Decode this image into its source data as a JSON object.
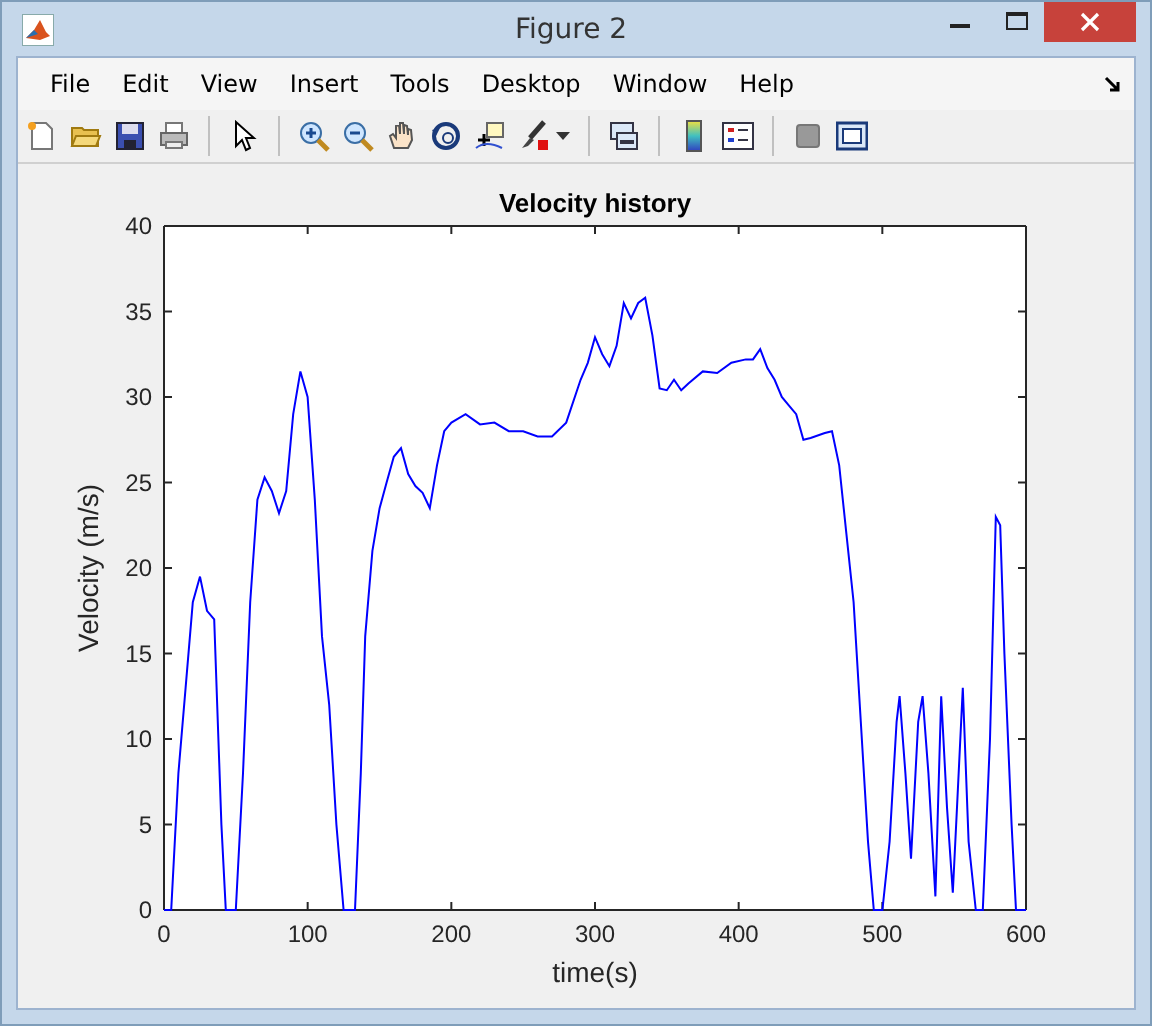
{
  "window": {
    "title": "Figure 2"
  },
  "menu": [
    "File",
    "Edit",
    "View",
    "Insert",
    "Tools",
    "Desktop",
    "Window",
    "Help"
  ],
  "figure": {
    "chart_data": {
      "type": "line",
      "title": "Velocity history",
      "xlabel": "time(s)",
      "ylabel": "Velocity (m/s)",
      "x": [
        0,
        5,
        10,
        15,
        20,
        25,
        30,
        35,
        40,
        43,
        50,
        55,
        60,
        65,
        70,
        75,
        80,
        85,
        90,
        95,
        100,
        105,
        110,
        115,
        120,
        125,
        133,
        137,
        140,
        145,
        150,
        155,
        160,
        165,
        170,
        175,
        180,
        185,
        190,
        195,
        200,
        210,
        220,
        230,
        240,
        250,
        260,
        270,
        280,
        290,
        295,
        300,
        305,
        310,
        315,
        320,
        325,
        330,
        335,
        340,
        345,
        350,
        355,
        360,
        365,
        375,
        385,
        395,
        405,
        410,
        415,
        420,
        425,
        430,
        435,
        440,
        445,
        450,
        460,
        465,
        470,
        475,
        480,
        485,
        490,
        494,
        500,
        505,
        510,
        512,
        516,
        520,
        525,
        528,
        532,
        537,
        541,
        545,
        549,
        552,
        556,
        560,
        565,
        570,
        575,
        579,
        582,
        585,
        590,
        593,
        600
      ],
      "series": [
        {
          "color": "#0000ff",
          "values": [
            0,
            0,
            8,
            13,
            18,
            19.5,
            17.5,
            17,
            5,
            0,
            0,
            8,
            18,
            24,
            25.3,
            24.5,
            23.2,
            24.5,
            29,
            31.5,
            30,
            24,
            16,
            12,
            5,
            0,
            0,
            8,
            16,
            21,
            23.5,
            25,
            26.5,
            27,
            25.5,
            24.8,
            24.4,
            23.5,
            26,
            28,
            28.5,
            29,
            28.4,
            28.5,
            28,
            28,
            27.7,
            27.7,
            28.5,
            31,
            32,
            33.5,
            32.5,
            31.8,
            33,
            35.5,
            34.6,
            35.5,
            35.8,
            33.6,
            30.5,
            30.4,
            31,
            30.4,
            30.8,
            31.5,
            31.4,
            32,
            32.2,
            32.2,
            32.8,
            31.7,
            31,
            30,
            29.5,
            29,
            27.5,
            27.6,
            27.9,
            28,
            26,
            22,
            18,
            11,
            4,
            0,
            0,
            4,
            11,
            12.5,
            8,
            3,
            11,
            12.5,
            8,
            0.8,
            12.5,
            6,
            1,
            6,
            13,
            4,
            0,
            0,
            10,
            23,
            22.5,
            15,
            5,
            0,
            0
          ]
        }
      ],
      "xlim": [
        0,
        600
      ],
      "ylim": [
        0,
        40
      ],
      "xticks": [
        0,
        100,
        200,
        300,
        400,
        500,
        600
      ],
      "yticks": [
        0,
        5,
        10,
        15,
        20,
        25,
        30,
        35,
        40
      ]
    }
  }
}
